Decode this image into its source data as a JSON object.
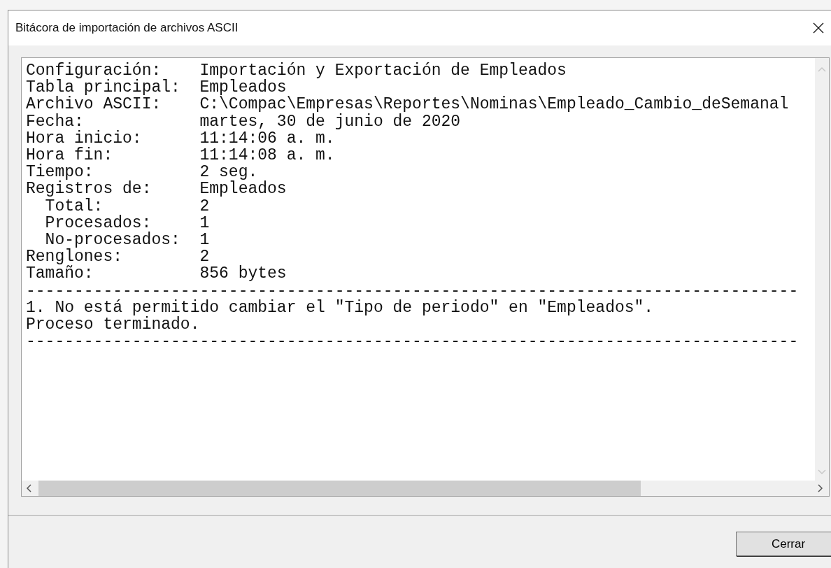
{
  "window": {
    "title": "Bitácora de importación de archivos ASCII"
  },
  "log": {
    "lines": [
      {
        "kind": "field",
        "label": "Configuración:",
        "value": "Importación y Exportación de Empleados"
      },
      {
        "kind": "field",
        "label": "Tabla principal:",
        "value": "Empleados"
      },
      {
        "kind": "field",
        "label": "Archivo ASCII:",
        "value": "C:\\Compac\\Empresas\\Reportes\\Nominas\\Empleado_Cambio_deSemanal"
      },
      {
        "kind": "field",
        "label": "Fecha:",
        "value": "martes, 30 de junio de 2020"
      },
      {
        "kind": "field",
        "label": "Hora inicio:",
        "value": "11:14:06 a. m."
      },
      {
        "kind": "field",
        "label": "Hora fin:",
        "value": "11:14:08 a. m."
      },
      {
        "kind": "field",
        "label": "Tiempo:",
        "value": "2 seg."
      },
      {
        "kind": "field",
        "label": "Registros de:",
        "value": "Empleados",
        "children": [
          {
            "kind": "field",
            "label": "Total:",
            "value": "2"
          },
          {
            "kind": "field",
            "label": "Procesados:",
            "value": "1"
          },
          {
            "kind": "field",
            "label": "No-procesados:",
            "value": "1"
          }
        ]
      },
      {
        "kind": "field",
        "label": "Renglones:",
        "value": "2"
      },
      {
        "kind": "field",
        "label": "Tamaño:",
        "value": "856 bytes"
      },
      {
        "kind": "rule",
        "text": "--------------------------------------------------------------------------------"
      },
      {
        "kind": "message",
        "text": "1. No está permitido cambiar el \"Tipo de periodo\" en \"Empleados\"."
      },
      {
        "kind": "message",
        "text": "Proceso terminado."
      },
      {
        "kind": "rule",
        "text": "--------------------------------------------------------------------------------"
      }
    ]
  },
  "buttons": [
    {
      "label": "Cerrar"
    }
  ]
}
